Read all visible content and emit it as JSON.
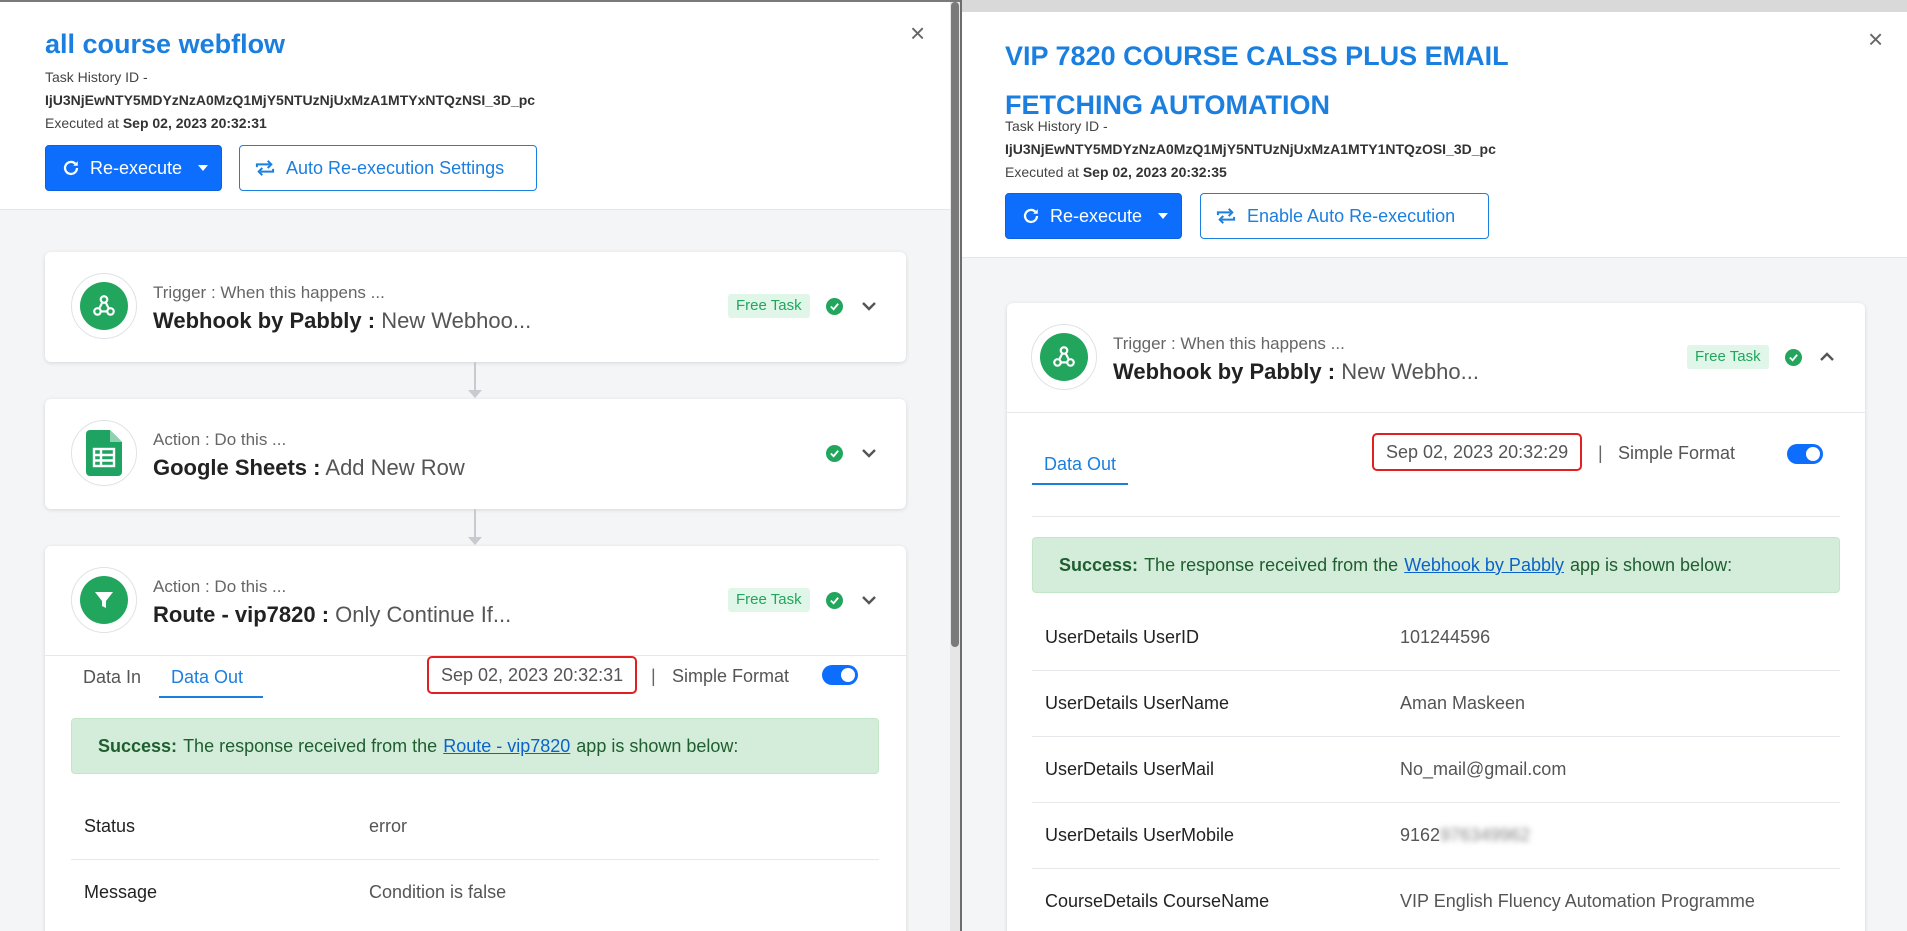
{
  "left": {
    "title": "all course webflow",
    "task_history_label": "Task History ID -",
    "task_history_id": "IjU3NjEwNTY5MDYzNzA0MzQ1MjY5NTUzNjUxMzA1MTYxNTQzNSI_3D_pc",
    "executed_label": "Executed at",
    "executed_at": "Sep 02, 2023 20:32:31",
    "reexecute_label": "Re-execute",
    "secondary_button_label": "Auto Re-execution Settings",
    "steps": [
      {
        "stage": "Trigger : When this happens ...",
        "app": "Webhook by Pabbly :",
        "event": "New Webhoo...",
        "badge": "Free Task",
        "icon": "webhook-icon"
      },
      {
        "stage": "Action : Do this ...",
        "app": "Google Sheets :",
        "event": "Add New Row",
        "badge": "",
        "icon": "google-sheets-icon"
      },
      {
        "stage": "Action : Do this ...",
        "app": "Route - vip7820 :",
        "event": "Only Continue If...",
        "badge": "Free Task",
        "icon": "filter-icon"
      }
    ],
    "tabs": [
      "Data In",
      "Data Out"
    ],
    "timestamp": "Sep 02, 2023 20:32:31",
    "pipe": "|",
    "format_label": "Simple Format",
    "alert": {
      "strong": "Success:",
      "before": "The response received from the",
      "link": "Route - vip7820",
      "after": "app is shown below:"
    },
    "rows": [
      {
        "key": "Status",
        "value": "error"
      },
      {
        "key": "Message",
        "value": "Condition is false"
      }
    ]
  },
  "right": {
    "title_line1": "VIP 7820 COURSE CALSS PLUS EMAIL",
    "title_line2": "FETCHING AUTOMATION",
    "task_history_label": "Task History ID -",
    "task_history_id": "IjU3NjEwNTY5MDYzNzA0MzQ1MjY5NTUzNjUxMzA1MTY1NTQzOSI_3D_pc",
    "executed_label": "Executed at",
    "executed_at": "Sep 02, 2023 20:32:35",
    "reexecute_label": "Re-execute",
    "secondary_button_label": "Enable Auto Re-execution",
    "step": {
      "stage": "Trigger : When this happens ...",
      "app": "Webhook by Pabbly :",
      "event": "New Webho...",
      "badge": "Free Task",
      "icon": "webhook-icon"
    },
    "tabs": [
      "Data Out"
    ],
    "timestamp": "Sep 02, 2023 20:32:29",
    "pipe": "|",
    "format_label": "Simple Format",
    "alert": {
      "strong": "Success:",
      "before": "The response received from the",
      "link": "Webhook by Pabbly",
      "after": "app is shown below:"
    },
    "rows": [
      {
        "key": "UserDetails UserID",
        "value": "101244596"
      },
      {
        "key": "UserDetails UserName",
        "value": "Aman Maskeen"
      },
      {
        "key": "UserDetails UserMail",
        "value": "No_mail@gmail.com"
      },
      {
        "key": "UserDetails UserMobile",
        "value": "9162",
        "value_blurred": "976349962"
      },
      {
        "key": "CourseDetails CourseName",
        "value": "VIP English Fluency Automation Programme"
      }
    ]
  },
  "close_glyph": "×",
  "colors": {
    "accent": "#1b7fe0",
    "primary": "#0d6efd",
    "success": "#22a65d",
    "highlight": "#e02020"
  }
}
